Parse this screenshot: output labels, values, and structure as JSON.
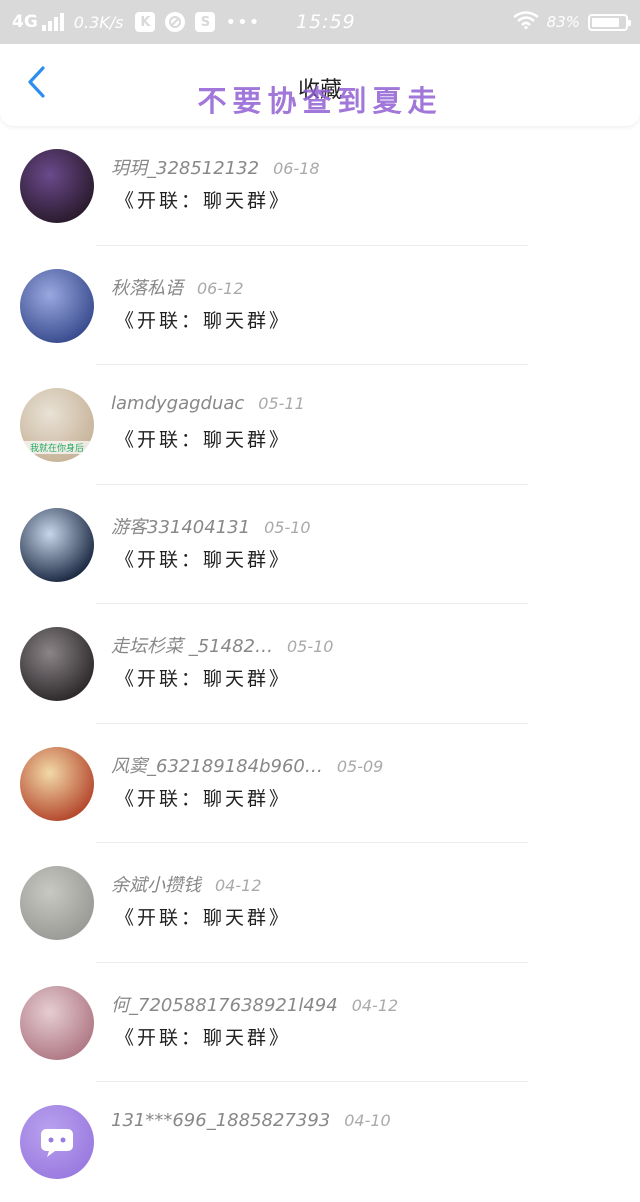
{
  "status_bar": {
    "network": "4G",
    "speed": "0.3K/s",
    "app_icon_1": "K",
    "app_icon_3": "S",
    "dots": "•••",
    "time": "15:59",
    "battery": "83%",
    "battery_level": 0.83
  },
  "header": {
    "title": "收藏",
    "overlay_caption": "不要协查到夏走",
    "accent_color": "#2b8ef0"
  },
  "items": [
    {
      "name": "玥玥_328512132",
      "date": "06-18",
      "message": "《开联：聊天群》",
      "avatar_colors": [
        "#2b1b2e",
        "#6a4a8c"
      ]
    },
    {
      "name": "秋落私语",
      "date": "06-12",
      "message": "《开联：聊天群》",
      "avatar_colors": [
        "#3a4d8f",
        "#9aa8e0"
      ]
    },
    {
      "name": "lamdygagduac",
      "date": "05-11",
      "message": "《开联：聊天群》",
      "avatar_colors": [
        "#c7b49a",
        "#e9e2d6"
      ],
      "avatar_caption": "我就在你身后"
    },
    {
      "name": "游客331404131",
      "date": "05-10",
      "message": "《开联：聊天群》",
      "avatar_colors": [
        "#1d2b45",
        "#c8d6ea"
      ]
    },
    {
      "name": "走坛杉菜 _51482…",
      "date": "05-10",
      "message": "《开联：聊天群》",
      "avatar_colors": [
        "#2e2a2c",
        "#8b8588"
      ]
    },
    {
      "name": "风窦_632189184b960…",
      "date": "05-09",
      "message": "《开联：聊天群》",
      "avatar_colors": [
        "#b5492e",
        "#f2d9a8"
      ]
    },
    {
      "name": "余斌小攒钱",
      "date": "04-12",
      "message": "《开联：聊天群》",
      "avatar_colors": [
        "#9a9a96",
        "#c9c9c4"
      ]
    },
    {
      "name": "何_72058817638921l494",
      "date": "04-12",
      "message": "《开联：聊天群》",
      "avatar_colors": [
        "#b07a86",
        "#e6cdd3"
      ]
    },
    {
      "name": "131***696_1885827393",
      "date": "04-10",
      "message": "",
      "avatar_colors": [
        "#9b7be0",
        "#b9a2ee"
      ]
    }
  ]
}
